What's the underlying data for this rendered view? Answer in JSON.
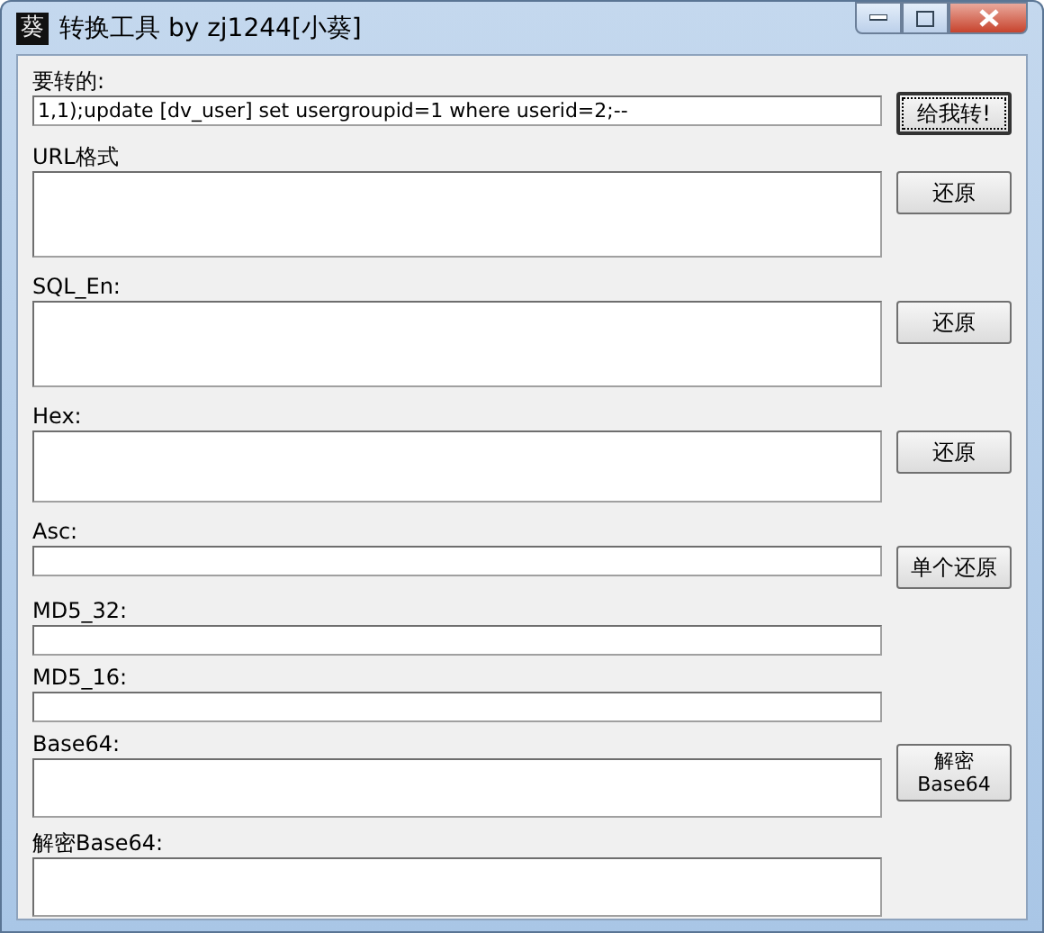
{
  "window": {
    "title": "转换工具 by zj1244[小葵]",
    "icon": "葵"
  },
  "sections": [
    {
      "label": "要转的:",
      "kind": "line",
      "value": "1,1);update [dv_user] set usergroupid=1 where userid=2;--",
      "button": "给我转!",
      "focused": true
    },
    {
      "label": "URL格式",
      "kind": "area",
      "button": "还原"
    },
    {
      "label": "SQL_En:",
      "kind": "area",
      "button": "还原"
    },
    {
      "label": "Hex:",
      "kind": "area",
      "button": "还原"
    },
    {
      "label": "Asc:",
      "kind": "line",
      "button": "单个还原"
    },
    {
      "label": "MD5_32:",
      "kind": "line"
    },
    {
      "label": "MD5_16:",
      "kind": "line"
    },
    {
      "label": "Base64:",
      "kind": "area",
      "button": "解密\nBase64"
    },
    {
      "label": "解密Base64:",
      "kind": "area"
    }
  ]
}
